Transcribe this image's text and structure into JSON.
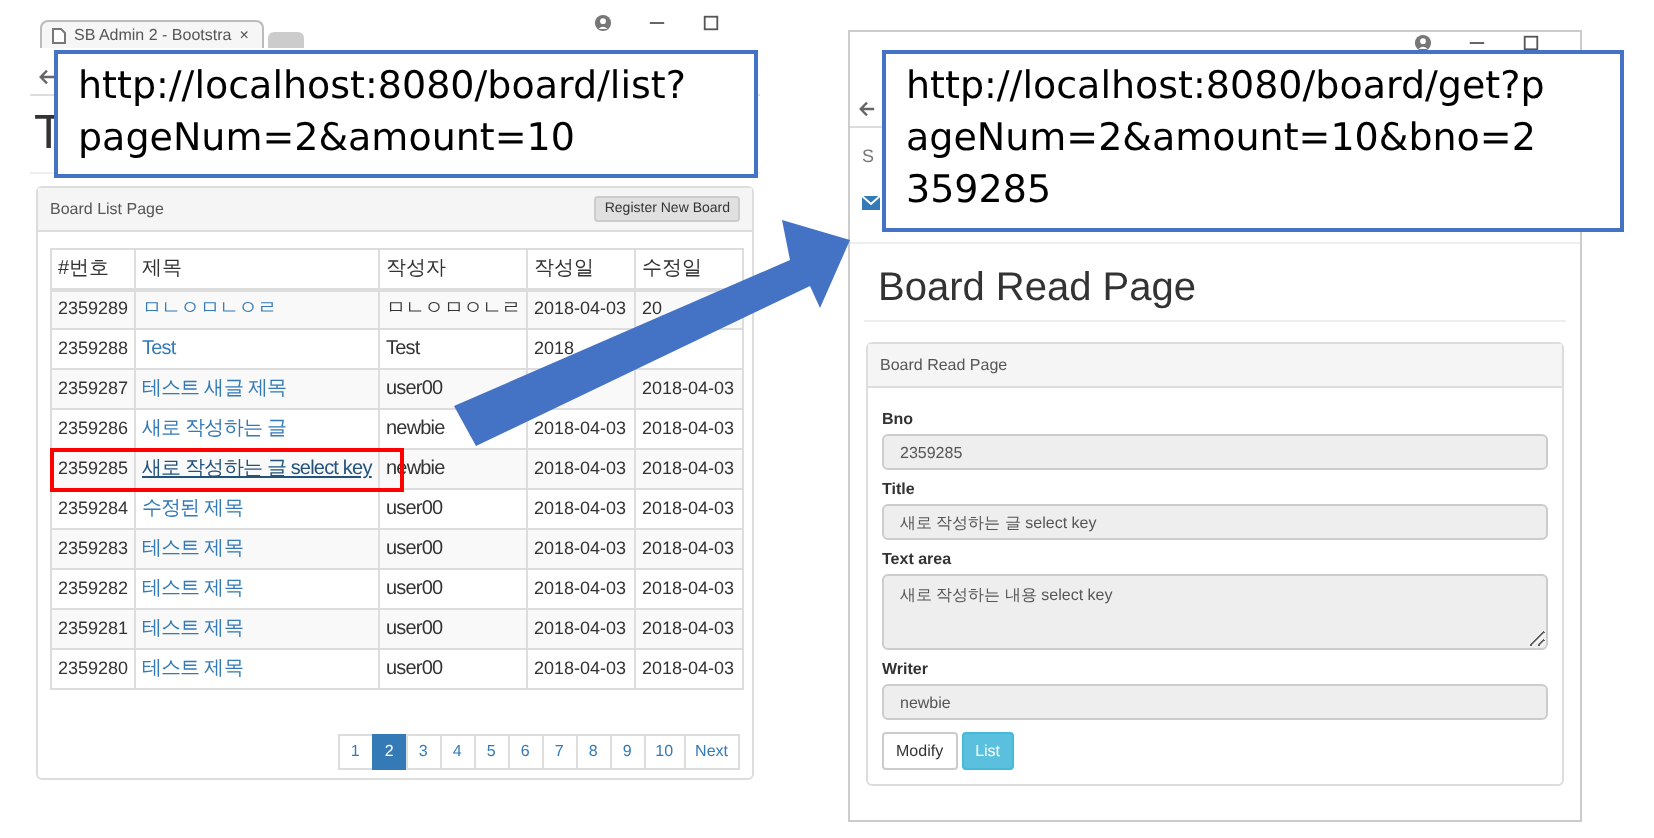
{
  "left_window": {
    "tab_title": "SB Admin 2 - Bootstra",
    "tab_close": "×",
    "heading": "T",
    "card_title": "Board List Page",
    "register_button": "Register New Board",
    "table": {
      "columns": [
        "#번호",
        "제목",
        "작성자",
        "작성일",
        "수정일"
      ],
      "rows": [
        {
          "cells": [
            "2359289",
            "ㅁㄴㅇㅁㄴㅇㄹ",
            "ㅁㄴㅇㅁㅇㄴㄹ",
            "2018-04-03",
            "20"
          ],
          "hovered": false
        },
        {
          "cells": [
            "2359288",
            "Test",
            "Test",
            "2018"
          ],
          "hovered": false
        },
        {
          "cells": [
            "2359287",
            "테스트 새글 제목",
            "user00"
          ],
          "modified": "2018-04-03",
          "hovered": false
        },
        {
          "cells": [
            "2359286",
            "새로 작성하는 글",
            "newbie",
            "2018-04-03",
            "2018-04-03"
          ],
          "hovered": false
        },
        {
          "cells": [
            "2359285",
            "새로 작성하는 글 select key",
            "newbie",
            "2018-04-03",
            "2018-04-03"
          ],
          "hovered": true
        },
        {
          "cells": [
            "2359284",
            "수정된 제목",
            "user00",
            "2018-04-03",
            "2018-04-03"
          ],
          "hovered": false
        },
        {
          "cells": [
            "2359283",
            "테스트 제목",
            "user00",
            "2018-04-03",
            "2018-04-03"
          ],
          "hovered": false
        },
        {
          "cells": [
            "2359282",
            "테스트 제목",
            "user00",
            "2018-04-03",
            "2018-04-03"
          ],
          "hovered": false
        },
        {
          "cells": [
            "2359281",
            "테스트 제목",
            "user00",
            "2018-04-03",
            "2018-04-03"
          ],
          "hovered": false
        },
        {
          "cells": [
            "2359280",
            "테스트 제목",
            "user00",
            "2018-04-03",
            "2018-04-03"
          ],
          "hovered": false
        }
      ]
    },
    "pagination": [
      {
        "label": "1",
        "selected": false
      },
      {
        "label": "2",
        "selected": true
      },
      {
        "label": "3",
        "selected": false
      },
      {
        "label": "4",
        "selected": false
      },
      {
        "label": "5",
        "selected": false
      },
      {
        "label": "6",
        "selected": false
      },
      {
        "label": "7",
        "selected": false
      },
      {
        "label": "8",
        "selected": false
      },
      {
        "label": "9",
        "selected": false
      },
      {
        "label": "10",
        "selected": false
      },
      {
        "label": "Next",
        "selected": false
      }
    ]
  },
  "left_url_callout": {
    "lines": [
      "http://localhost:8080/board/list?",
      "pageNum=2&amount=10"
    ]
  },
  "right_window": {
    "sidebar_fragment": "S",
    "heading": "Board Read Page",
    "card_title": "Board Read Page",
    "fields": [
      {
        "label": "Bno",
        "value": "2359285",
        "kind": "input"
      },
      {
        "label": "Title",
        "value": "새로 작성하는 글 select key",
        "kind": "input"
      },
      {
        "label": "Text area",
        "value": "새로 작성하는 내용 select key",
        "kind": "textarea"
      },
      {
        "label": "Writer",
        "value": "newbie",
        "kind": "input"
      }
    ],
    "buttons": [
      {
        "label": "Modify",
        "kind": "default"
      },
      {
        "label": "List",
        "kind": "info"
      }
    ]
  },
  "right_url_callout": {
    "lines": [
      "http://localhost:8080/board/get?p",
      "ageNum=2&amount=10&bno=2",
      "359285"
    ]
  }
}
